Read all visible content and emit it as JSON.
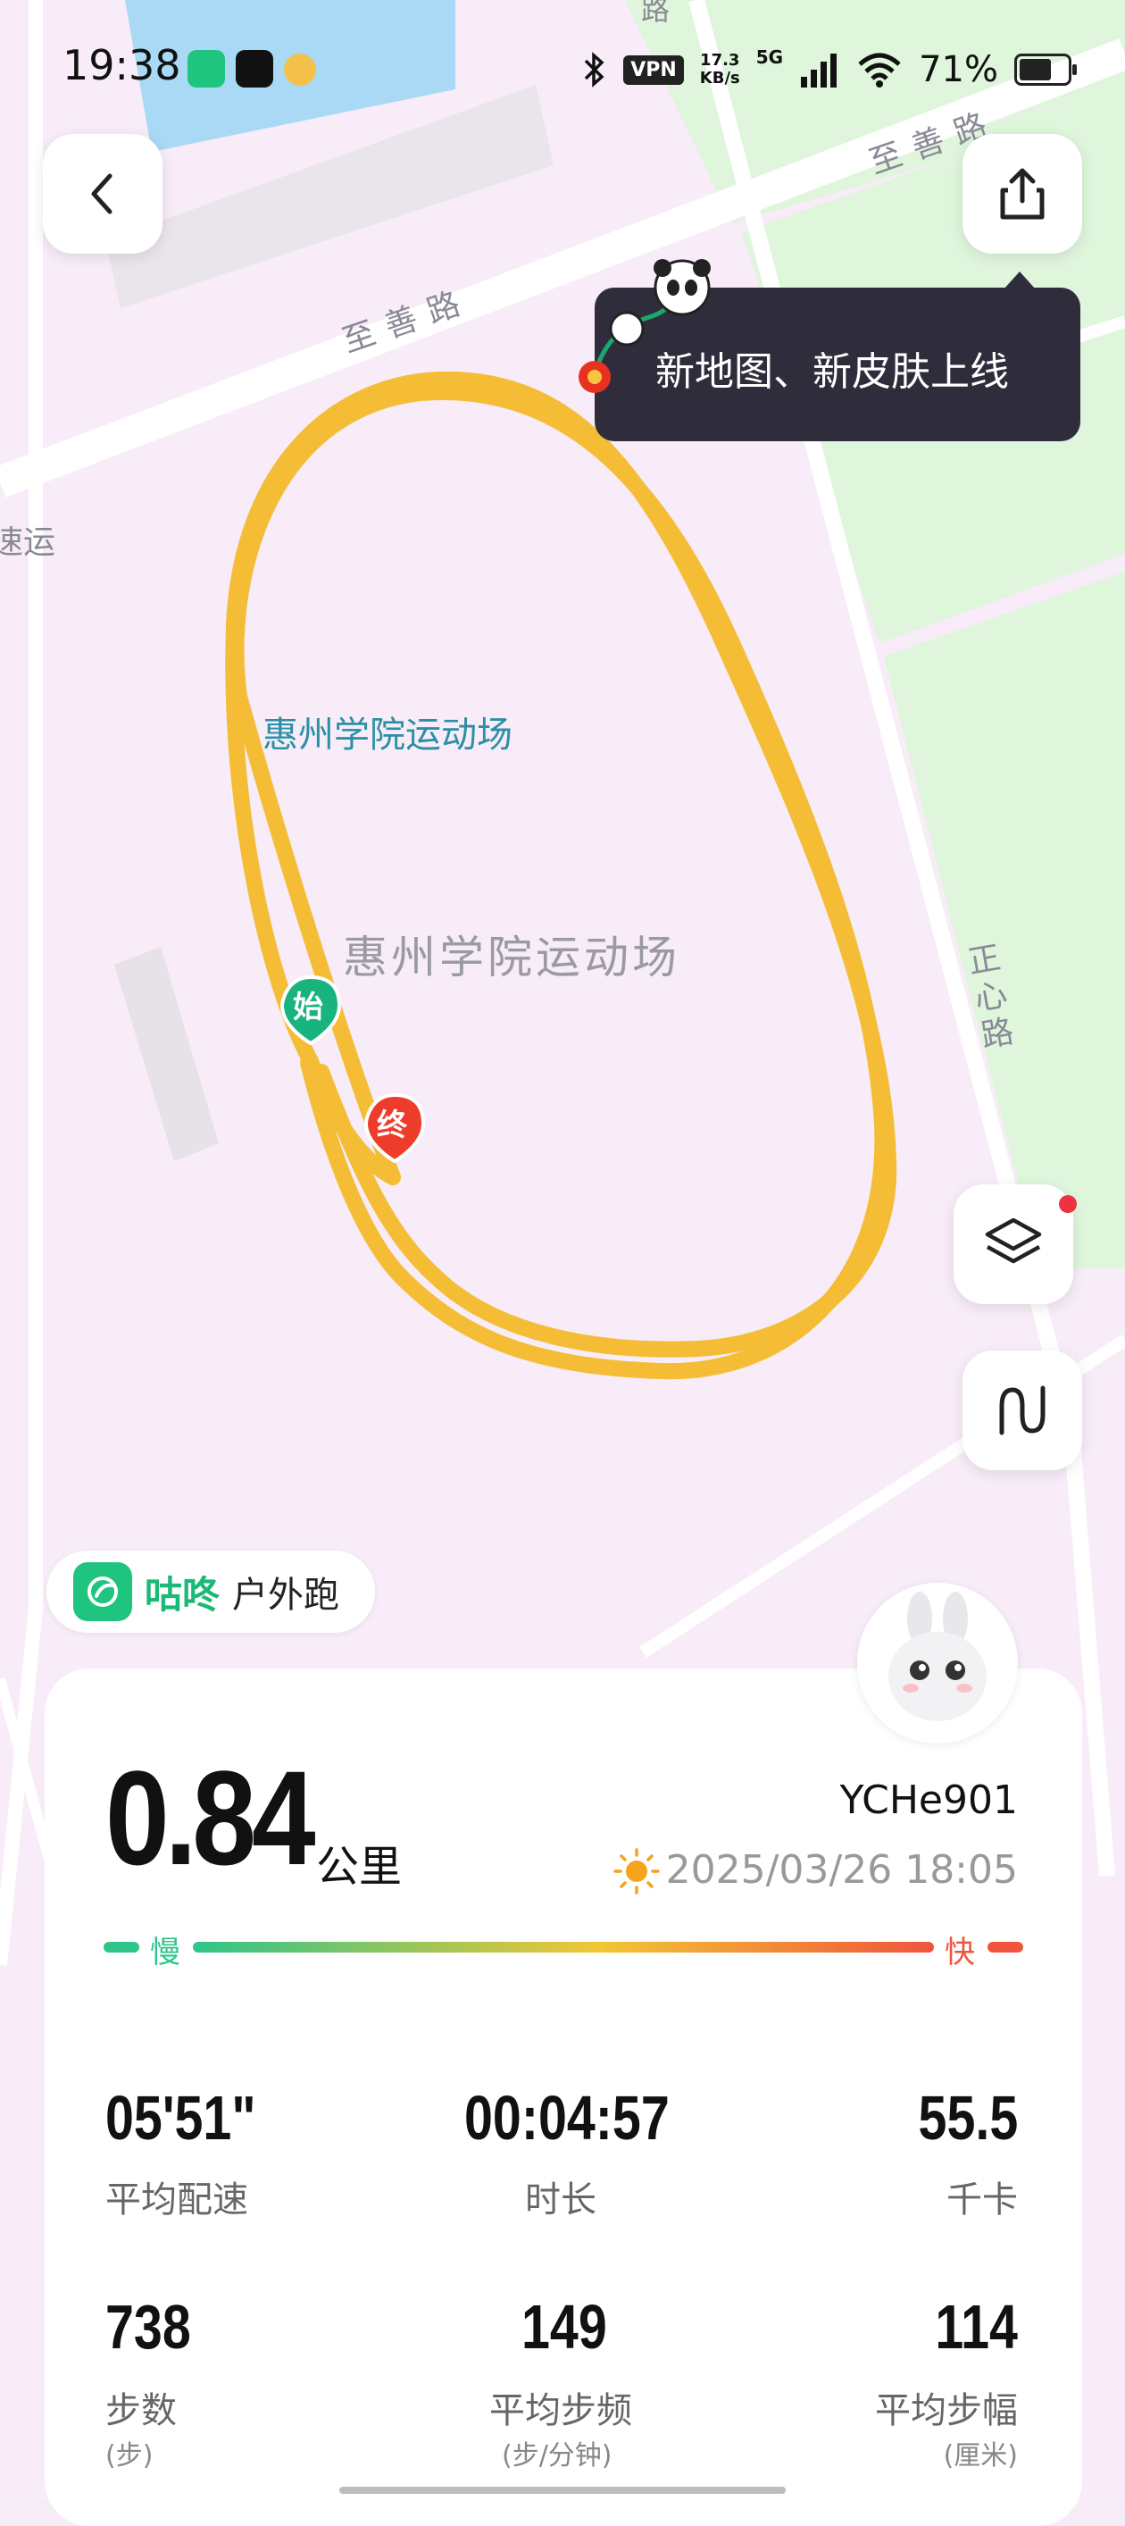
{
  "status_bar": {
    "time": "19:38",
    "network_speed_value": "17.3",
    "network_speed_unit": "KB/s",
    "vpn": "VPN",
    "signal_type": "5G",
    "battery": "71%"
  },
  "map": {
    "labels": {
      "road_top": "至善路",
      "road_top_right": "至善路",
      "road_right": "正心路",
      "road_left_fragment": "速运",
      "road_top_fragment": "路",
      "venue_blue": "惠州学院运动场",
      "venue_gray": "惠州学院运动场"
    },
    "start_marker": "始",
    "end_marker": "终",
    "track_color": "#f4bd35"
  },
  "tooltip": {
    "text": "新地图、新皮肤上线"
  },
  "brand": {
    "name": "咕咚",
    "mode": "户外跑"
  },
  "summary": {
    "distance": "0.84",
    "distance_unit": "公里",
    "username": "YCHe901",
    "datetime": "2025/03/26 18:05",
    "slow_label": "慢",
    "fast_label": "快"
  },
  "stats": [
    {
      "value": "05'51\"",
      "label": "平均配速",
      "sub": ""
    },
    {
      "value": "00:04:57",
      "label": "时长",
      "sub": ""
    },
    {
      "value": "55.5",
      "label": "千卡",
      "sub": ""
    },
    {
      "value": "738",
      "label": "步数",
      "sub": "(步)"
    },
    {
      "value": "149",
      "label": "平均步频",
      "sub": "(步/分钟)"
    },
    {
      "value": "114",
      "label": "平均步幅",
      "sub": "(厘米)"
    }
  ],
  "colors": {
    "accent_green": "#1fc47f",
    "speed_slow": "#2fc48a",
    "speed_fast": "#f0543c",
    "track": "#f4bd35"
  }
}
